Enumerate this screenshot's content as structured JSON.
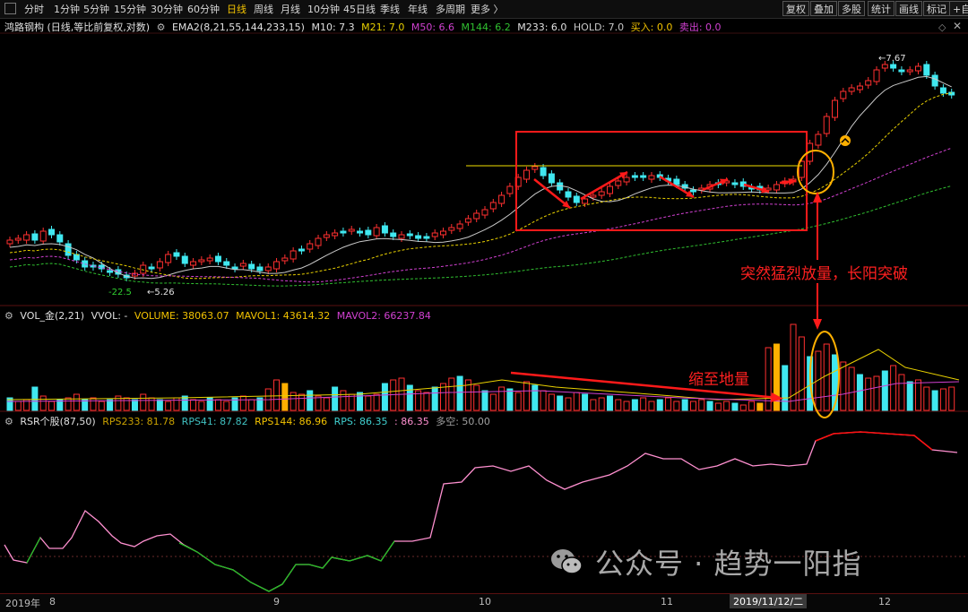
{
  "toolbar": {
    "tabs": [
      "分时",
      "1分钟",
      "5分钟",
      "15分钟",
      "30分钟",
      "60分钟",
      "日线",
      "周线",
      "月线",
      "10分钟",
      "45日线",
      "季线",
      "年线",
      "多周期",
      "更多 〉"
    ],
    "active_tab": "日线",
    "right_buttons": [
      "复权",
      "叠加",
      "多股",
      "统计",
      "画线",
      "标记",
      "+自"
    ]
  },
  "main_legend": {
    "stock": "鸿路钢构 (日线,等比前复权,对数)",
    "indicator": "EMA2(8,21,55,144,233,15)",
    "m10": "M10: 7.3",
    "m21": "M21: 7.0",
    "m50": "M50: 6.6",
    "m144": "M144: 6.2",
    "m233": "M233: 6.0",
    "hold": "HOLD: 7.0",
    "buy": "买入: 0.0",
    "sell": "卖出: 0.0"
  },
  "vol_legend": {
    "name": "VOL_金(2,21)",
    "vvol": "VVOL: -",
    "volume": "VOLUME: 38063.07",
    "mavol1": "MAVOL1: 43614.32",
    "mavol2": "MAVOL2: 66237.84"
  },
  "rsr_legend": {
    "name": "RSR个股(87,50)",
    "rps233": "RPS233: 81.78",
    "rps41": "RPS41: 87.82",
    "rps144": "RPS144: 86.96",
    "rps": "RPS: 86.35",
    "rps2": ": 86.35",
    "duokong": "多空: 50.00"
  },
  "price_labels": {
    "high": "7.67",
    "low": "5.26",
    "pct": "-22.5"
  },
  "annotations": {
    "breakout": "突然猛烈放量，长阳突破",
    "shrink": "缩至地量"
  },
  "axis": {
    "year": "2019年",
    "m8": "8",
    "m9": "9",
    "m10": "10",
    "m11": "11",
    "cursor_date": "2019/11/12/二",
    "m12": "12"
  },
  "watermark": "公众号 · 趋势一阳指",
  "colors": {
    "up": "#ff3030",
    "down": "#40e8f0",
    "highlight": "#ffb000",
    "ma_white": "#c8c8c8",
    "ma_yellow": "#e8d000",
    "ma_magenta": "#d040d0",
    "ma_green": "#30c030",
    "rsr_pink": "#ff90d0",
    "rsr_red": "#ff1010",
    "rsr_green": "#20c020"
  },
  "icons": {
    "buy_marker": "chevron-up-circle-icon",
    "wechat": "wechat-icon"
  }
}
